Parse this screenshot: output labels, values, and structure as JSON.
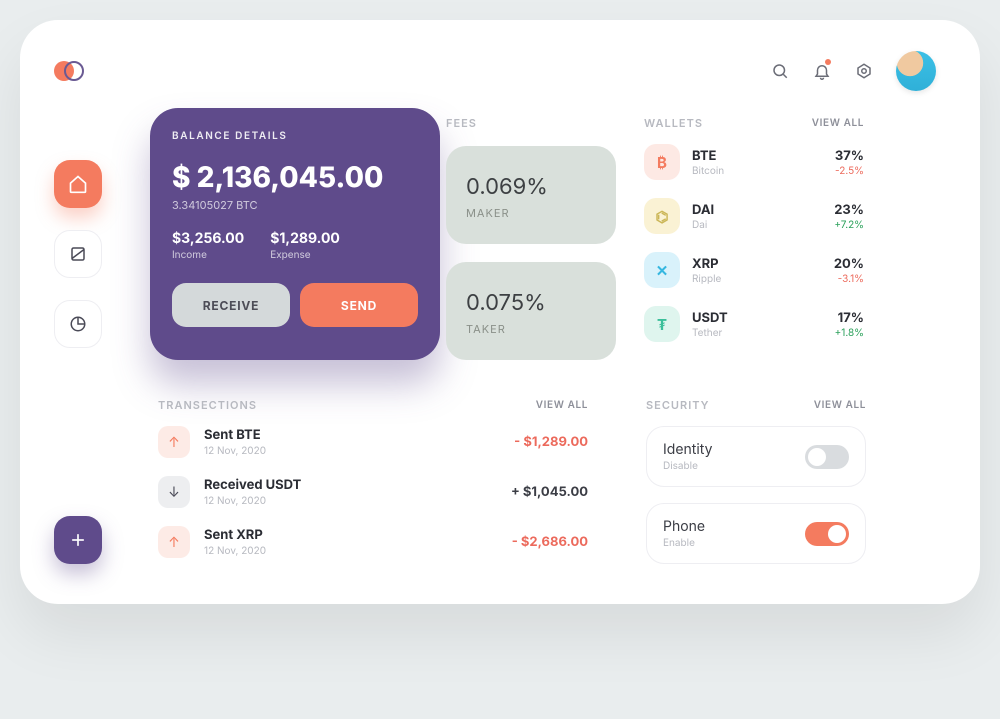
{
  "balance": {
    "label": "BALANCE DETAILS",
    "amount": "$ 2,136,045.00",
    "sub": "3.34105027 BTC",
    "income_value": "$3,256.00",
    "income_label": "Income",
    "expense_value": "$1,289.00",
    "expense_label": "Expense",
    "receive_label": "RECEIVE",
    "send_label": "SEND"
  },
  "fees": {
    "title": "FEES",
    "maker_pct": "0.069%",
    "maker_label": "MAKER",
    "taker_pct": "0.075%",
    "taker_label": "TAKER"
  },
  "wallets": {
    "title": "WALLETS",
    "view_all": "VIEW ALL",
    "items": [
      {
        "icon": "₿",
        "sym": "BTE",
        "name": "Bitcoin",
        "pct": "37%",
        "chg": "-2.5%",
        "chg_sign": "neg",
        "bg": "#fde9e4",
        "fg": "#f47b5f"
      },
      {
        "icon": "⌬",
        "sym": "DAI",
        "name": "Dai",
        "pct": "23%",
        "chg": "+7.2%",
        "chg_sign": "pos",
        "bg": "#faf2d4",
        "fg": "#cbb657"
      },
      {
        "icon": "✕",
        "sym": "XRP",
        "name": "Ripple",
        "pct": "20%",
        "chg": "-3.1%",
        "chg_sign": "neg",
        "bg": "#d9f2fb",
        "fg": "#35b7e0"
      },
      {
        "icon": "₮",
        "sym": "USDT",
        "name": "Tether",
        "pct": "17%",
        "chg": "+1.8%",
        "chg_sign": "pos",
        "bg": "#dff5ee",
        "fg": "#3bbf9a"
      }
    ]
  },
  "transactions": {
    "title": "TRANSECTIONS",
    "view_all": "VIEW ALL",
    "items": [
      {
        "dir": "up",
        "title": "Sent BTE",
        "date": "12 Nov, 2020",
        "amount": "- $1,289.00",
        "sign": "neg"
      },
      {
        "dir": "down",
        "title": "Received USDT",
        "date": "12 Nov, 2020",
        "amount": "+ $1,045.00",
        "sign": "pos"
      },
      {
        "dir": "up",
        "title": "Sent XRP",
        "date": "12 Nov, 2020",
        "amount": "- $2,686.00",
        "sign": "neg"
      }
    ]
  },
  "security": {
    "title": "SECURITY",
    "view_all": "VIEW ALL",
    "items": [
      {
        "title": "Identity",
        "state_label": "Disable",
        "on": false
      },
      {
        "title": "Phone",
        "state_label": "Enable",
        "on": true
      }
    ]
  }
}
